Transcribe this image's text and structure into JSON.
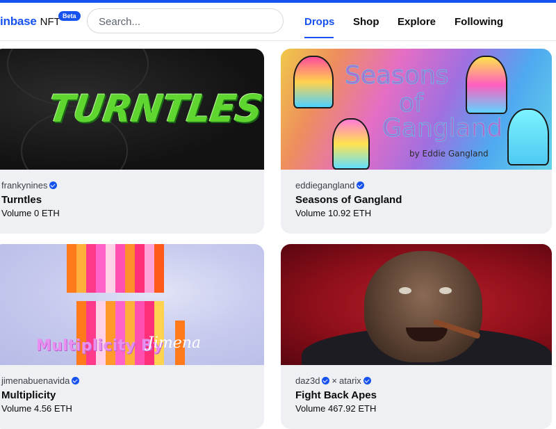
{
  "header": {
    "brand_name": "inbase",
    "brand_suffix": "NFT",
    "beta_badge": "Beta",
    "search_placeholder": "Search...",
    "nav": [
      {
        "label": "Drops",
        "active": true
      },
      {
        "label": "Shop",
        "active": false
      },
      {
        "label": "Explore",
        "active": false
      },
      {
        "label": "Following",
        "active": false
      }
    ]
  },
  "colors": {
    "accent": "#1652f0",
    "card_background": "#eef0f3"
  },
  "cards": [
    {
      "creator": "frankynines",
      "verified": true,
      "title": "Turntles",
      "volume": "Volume 0 ETH",
      "art_text": "TURNTLES"
    },
    {
      "creator": "eddiegangland",
      "verified": true,
      "title": "Seasons of Gangland",
      "volume": "Volume 10.92 ETH",
      "art_text": [
        "Seasons",
        "of",
        "Gangland",
        "by Eddie Gangland"
      ]
    },
    {
      "creator": "jimenabuenavida",
      "verified": true,
      "title": "Multiplicity",
      "volume": "Volume 4.56 ETH",
      "art_text": [
        "Multiplicity By",
        "Jimena"
      ]
    },
    {
      "creator": "daz3d",
      "verified": true,
      "creator2": "atarix",
      "verified2": true,
      "separator": "×",
      "title": "Fight Back Apes",
      "volume": "Volume 467.92 ETH"
    }
  ]
}
